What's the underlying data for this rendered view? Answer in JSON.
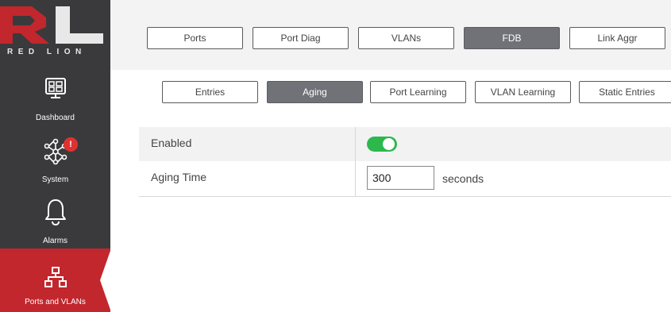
{
  "logo": {
    "brand": "RL",
    "name": "RED LION"
  },
  "sidebar": {
    "items": [
      {
        "label": "Dashboard",
        "icon": "dashboard-icon"
      },
      {
        "label": "System",
        "icon": "system-network-icon",
        "badge": "!"
      },
      {
        "label": "Alarms",
        "icon": "bell-icon"
      },
      {
        "label": "Ports and VLANs",
        "icon": "network-topology-icon",
        "active": true
      }
    ]
  },
  "top_tabs": [
    {
      "label": "Ports"
    },
    {
      "label": "Port Diag"
    },
    {
      "label": "VLANs"
    },
    {
      "label": "FDB",
      "active": true
    },
    {
      "label": "Link Aggr"
    }
  ],
  "sub_tabs": [
    {
      "label": "Entries"
    },
    {
      "label": "Aging",
      "active": true
    },
    {
      "label": "Port Learning"
    },
    {
      "label": "VLAN Learning"
    },
    {
      "label": "Static Entries"
    }
  ],
  "settings": {
    "enabled_label": "Enabled",
    "enabled_value": true,
    "aging_time_label": "Aging Time",
    "aging_time_value": "300",
    "aging_time_unit": "seconds"
  },
  "colors": {
    "sidebar_bg": "#3a3a3c",
    "accent_red": "#c1272d",
    "active_tab": "#707277",
    "toggle_on": "#2db84d"
  }
}
